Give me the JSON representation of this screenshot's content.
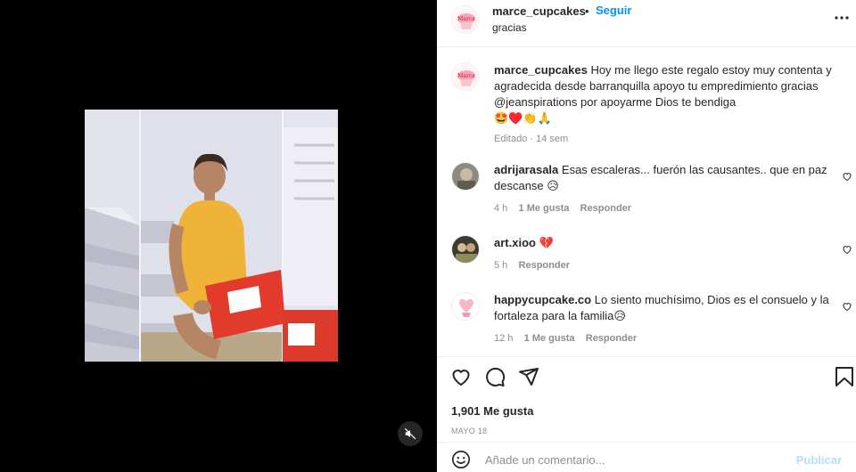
{
  "header": {
    "username": "marce_cupcakes",
    "separator": "•",
    "follow_label": "Seguir",
    "subtitle": "gracias",
    "avatar_icon": "cupcake-logo-icon",
    "more_icon": "more-options-icon"
  },
  "caption": {
    "username": "marce_cupcakes",
    "text": "Hoy me llego este regalo estoy muy contenta y agradecida desde barranquilla apoyo tu empredimiento gracias @jeanspirations por apoyarme Dios te bendiga",
    "emojis": "🤩♥️👏🙏",
    "meta": "Editado · 14 sem"
  },
  "comments": [
    {
      "username": "adrijarasala",
      "text": "Esas escaleras... fuerón las causantes.. que en paz descanse 😥",
      "time": "4 h",
      "likes": "1 Me gusta",
      "reply": "Responder"
    },
    {
      "username": "art.xioo",
      "text": "💔",
      "time": "5 h",
      "likes": "",
      "reply": "Responder"
    },
    {
      "username": "happycupcake.co",
      "text": "Lo siento muchísimo, Dios es el consuelo y la fortaleza para la familia😥",
      "time": "12 h",
      "likes": "1 Me gusta",
      "reply": "Responder"
    }
  ],
  "actions": {
    "like_icon": "heart-icon",
    "comment_icon": "comment-icon",
    "share_icon": "share-icon",
    "save_icon": "bookmark-icon"
  },
  "likes_count": "1,901 Me gusta",
  "date": "MAYO 18",
  "add_comment": {
    "placeholder": "Añade un comentario...",
    "post_label": "Publicar"
  },
  "colors": {
    "link_blue": "#0095f6",
    "publish_disabled": "#b2dffc",
    "muted_text": "#8e8e8e"
  }
}
